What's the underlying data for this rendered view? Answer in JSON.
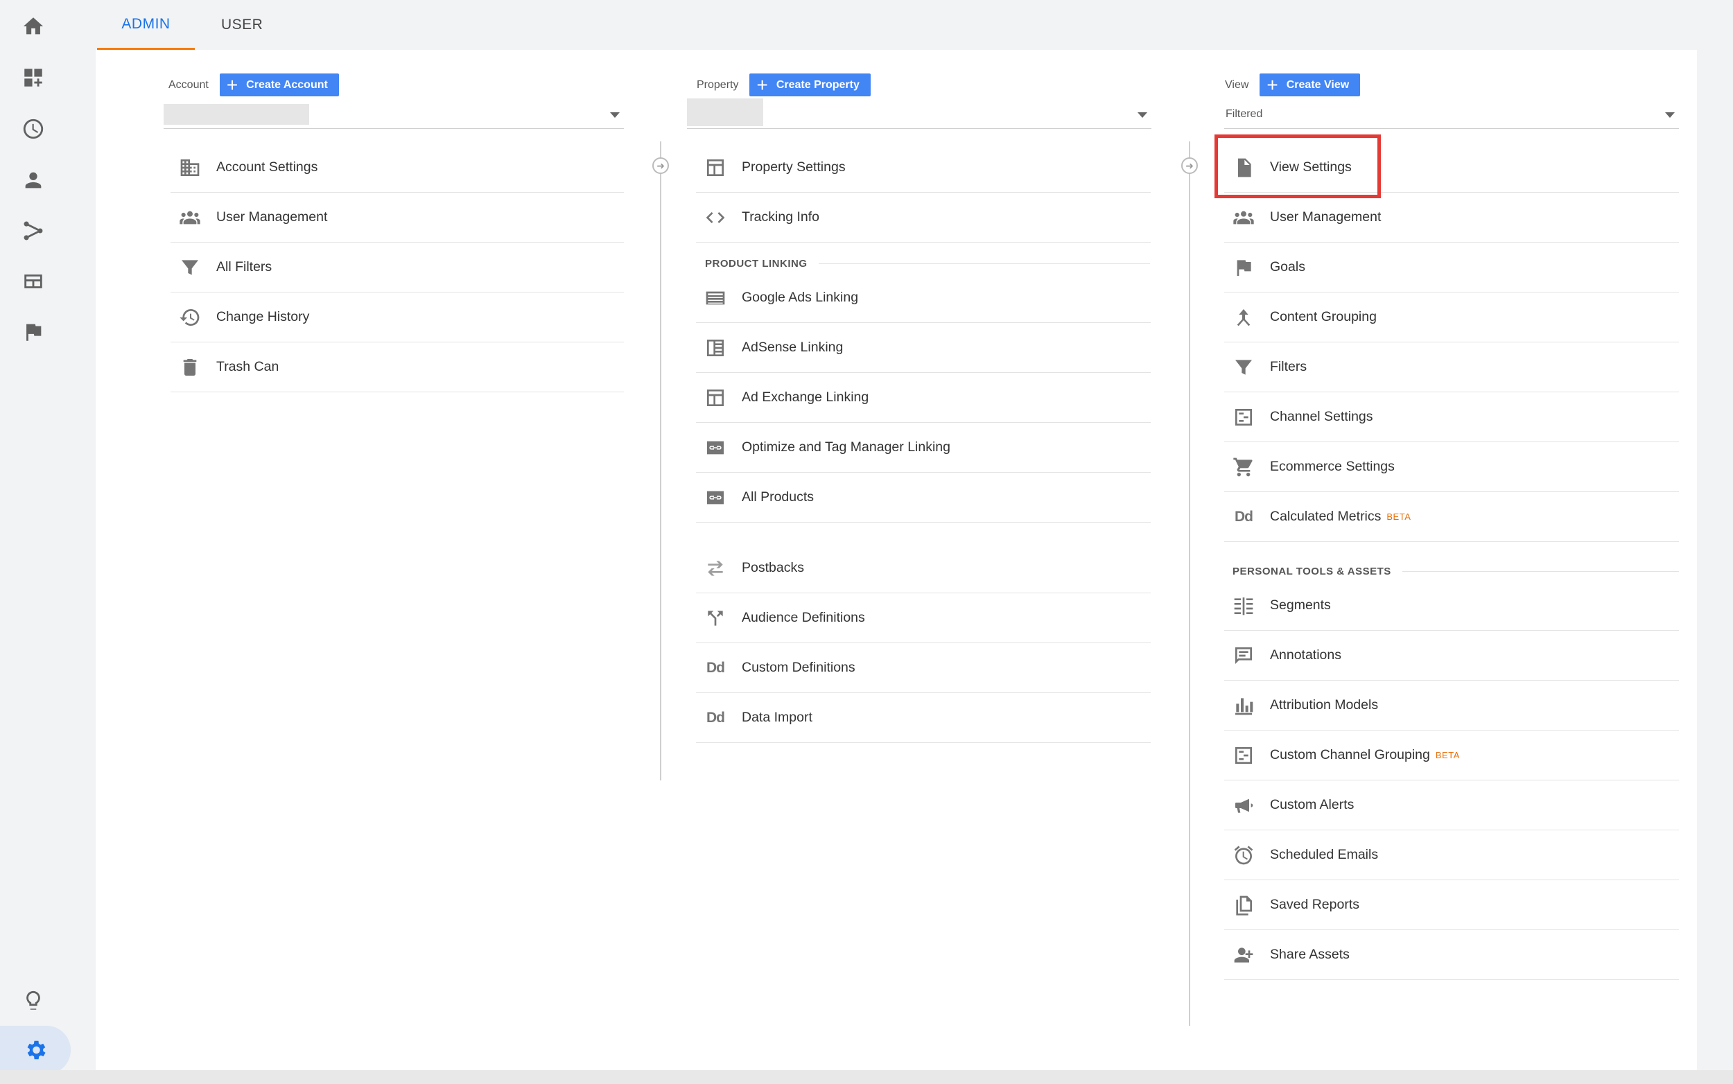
{
  "tabs": {
    "admin": "ADMIN",
    "user": "USER"
  },
  "rail": {
    "icons": [
      "home-icon",
      "dashboard-icon",
      "clock-icon",
      "person-icon",
      "acquisition-icon",
      "behavior-icon",
      "flag-icon",
      "lightbulb-icon",
      "settings-icon"
    ]
  },
  "account": {
    "label": "Account",
    "create": "Create Account",
    "items": [
      {
        "label": "Account Settings",
        "icon": "building-icon"
      },
      {
        "label": "User Management",
        "icon": "people-icon"
      },
      {
        "label": "All Filters",
        "icon": "filter-icon"
      },
      {
        "label": "Change History",
        "icon": "history-icon"
      },
      {
        "label": "Trash Can",
        "icon": "trash-icon"
      }
    ]
  },
  "property": {
    "label": "Property",
    "create": "Create Property",
    "items": [
      {
        "label": "Property Settings",
        "icon": "window-icon"
      },
      {
        "label": "Tracking Info",
        "icon": "code-icon"
      }
    ],
    "section": "PRODUCT LINKING",
    "linking": [
      {
        "label": "Google Ads Linking",
        "icon": "ads-icon"
      },
      {
        "label": "AdSense Linking",
        "icon": "adsense-icon"
      },
      {
        "label": "Ad Exchange Linking",
        "icon": "window-icon"
      },
      {
        "label": "Optimize and Tag Manager Linking",
        "icon": "link-icon"
      },
      {
        "label": "All Products",
        "icon": "link-icon"
      }
    ],
    "extra": [
      {
        "label": "Postbacks",
        "icon": "postbacks-icon"
      },
      {
        "label": "Audience Definitions",
        "icon": "fork-icon"
      },
      {
        "label": "Custom Definitions",
        "icon": "dd-icon",
        "glyph": "Dd"
      },
      {
        "label": "Data Import",
        "icon": "dd-icon",
        "glyph": "Dd"
      }
    ]
  },
  "view": {
    "label": "View",
    "create": "Create View",
    "selected": "Filtered",
    "items": [
      {
        "label": "View Settings",
        "icon": "document-icon"
      },
      {
        "label": "User Management",
        "icon": "people-icon"
      },
      {
        "label": "Goals",
        "icon": "flag-icon"
      },
      {
        "label": "Content Grouping",
        "icon": "grouping-icon"
      },
      {
        "label": "Filters",
        "icon": "filter-icon"
      },
      {
        "label": "Channel Settings",
        "icon": "channel-icon"
      },
      {
        "label": "Ecommerce Settings",
        "icon": "cart-icon"
      },
      {
        "label": "Calculated Metrics",
        "icon": "dd-icon",
        "glyph": "Dd",
        "badge": "BETA"
      }
    ],
    "section": "PERSONAL TOOLS & ASSETS",
    "tools": [
      {
        "label": "Segments",
        "icon": "segments-icon"
      },
      {
        "label": "Annotations",
        "icon": "comment-icon"
      },
      {
        "label": "Attribution Models",
        "icon": "bar-chart-icon"
      },
      {
        "label": "Custom Channel Grouping",
        "icon": "channel-icon",
        "badge": "BETA"
      },
      {
        "label": "Custom Alerts",
        "icon": "megaphone-icon"
      },
      {
        "label": "Scheduled Emails",
        "icon": "alarm-icon"
      },
      {
        "label": "Saved Reports",
        "icon": "copy-icon"
      },
      {
        "label": "Share Assets",
        "icon": "person-add-icon"
      }
    ]
  }
}
